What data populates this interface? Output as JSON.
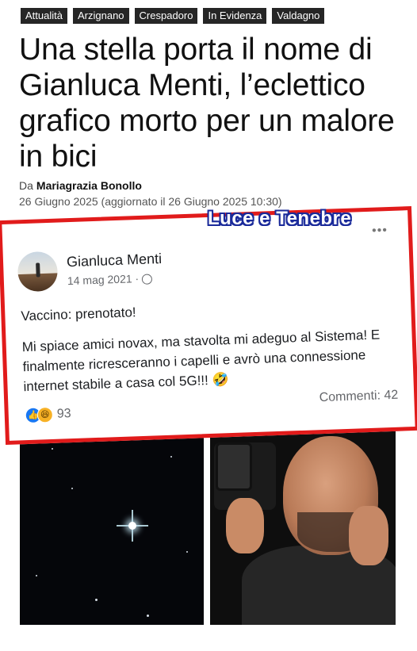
{
  "tags": [
    "Attualità",
    "Arzignano",
    "Crespadoro",
    "In Evidenza",
    "Valdagno"
  ],
  "article": {
    "title": "Una stella porta il nome di Gianluca Menti, l’eclettico grafico morto per un malore in bici",
    "byline_prefix": "Da",
    "author": "Mariagrazia Bonollo",
    "date": "26 Giugno 2025 (aggiornato il 26 Giugno 2025 10:30)"
  },
  "overlay_label": "Luce e Tenebre",
  "post": {
    "name": "Gianluca Menti",
    "date": "14 mag 2021 ·",
    "more": "•••",
    "line1": "Vaccino: prenotato!",
    "line2": "Mi spiace amici novax, ma stavolta mi adeguo al Sistema! E finalmente ricresceranno i capelli e avrò una connessione internet stabile a casa col 5G!!! 🤣",
    "reaction_count": "93",
    "comments": "Commenti: 42"
  },
  "colors": {
    "tag_bg": "#262626",
    "frame_red": "#e11b1b",
    "fb_blue": "#1877f2",
    "label_outline": "#1a2a9a"
  },
  "icons": [
    "globe-icon",
    "like-reaction-icon",
    "haha-reaction-icon",
    "more-options-icon"
  ]
}
